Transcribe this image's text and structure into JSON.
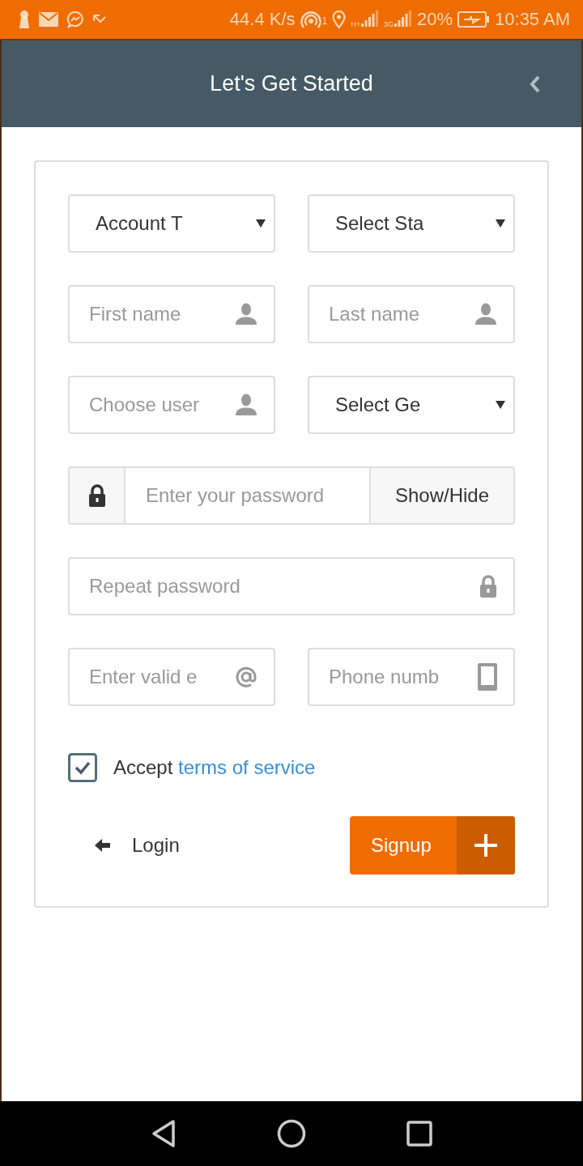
{
  "status_bar": {
    "net_speed": "44.4 K/s",
    "hotspot_count": "1",
    "networks": [
      {
        "label": "H+"
      },
      {
        "label": "3G"
      }
    ],
    "battery": "20%",
    "time": "10:35 AM"
  },
  "header": {
    "title": "Let's Get Started"
  },
  "form": {
    "rows": [
      {
        "fields": [
          {
            "kind": "select",
            "value": "Account T"
          },
          {
            "kind": "select",
            "value": "Select Sta"
          }
        ]
      },
      {
        "fields": [
          {
            "kind": "person_input",
            "placeholder": "First name"
          },
          {
            "kind": "person_input",
            "placeholder": "Last name"
          }
        ]
      },
      {
        "fields": [
          {
            "kind": "person_input",
            "placeholder": "Choose user"
          },
          {
            "kind": "select",
            "value": "Select Ge"
          }
        ]
      },
      {
        "fields": [
          {
            "kind": "password_group",
            "placeholder": "Enter your password",
            "button": "Show/Hide"
          }
        ]
      },
      {
        "fields": [
          {
            "kind": "lock_input",
            "placeholder": "Repeat password"
          }
        ]
      },
      {
        "fields": [
          {
            "kind": "email_input",
            "placeholder": "Enter valid e"
          },
          {
            "kind": "phone_input",
            "placeholder": "Phone numb"
          }
        ]
      }
    ],
    "terms": {
      "checked": true,
      "text": "Accept",
      "link": "terms of service"
    },
    "login": "Login",
    "signup": "Signup"
  }
}
